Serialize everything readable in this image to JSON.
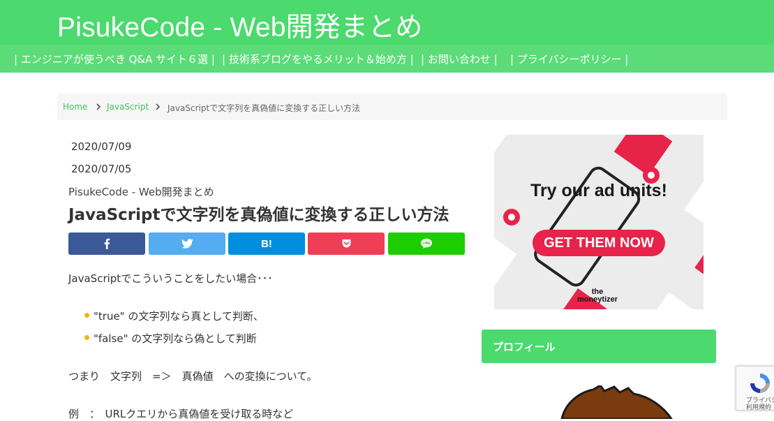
{
  "header": {
    "site_title": "PisukeCode - Web開発まとめ",
    "nav": [
      "| エンジニアが使うべき Q&A サイト６選 |",
      "| 技術系ブログをやるメリット＆始め方 |",
      "| お問い合わせ |",
      "| プライバシーポリシー |"
    ]
  },
  "breadcrumb": {
    "home": "Home",
    "category": "JavaScript",
    "current": "JavaScriptで文字列を真偽値に変換する正しい方法"
  },
  "post": {
    "updated_date": "2020/07/09",
    "published_date": "2020/07/05",
    "author": "PisukeCode - Web開発まとめ",
    "title": "JavaScriptで文字列を真偽値に変換する正しい方法",
    "share_buttons": [
      {
        "name": "facebook",
        "glyph": "f",
        "color": "#3b5998"
      },
      {
        "name": "twitter",
        "glyph": "t",
        "color": "#55acee"
      },
      {
        "name": "hatena",
        "glyph": "B!",
        "color": "#008fde"
      },
      {
        "name": "pocket",
        "glyph": "p",
        "color": "#ef3f56"
      },
      {
        "name": "line",
        "glyph": "LINE",
        "color": "#1dcd00"
      }
    ],
    "intro": "JavaScriptでこういうことをしたい場合･･･",
    "list": [
      "\"true\" の文字列なら真として判断、",
      "\"false\" の文字列なら偽として判断"
    ],
    "summary": "つまり　文字列　=＞　真偽値　への変換について。",
    "example": "例　：　URLクエリから真偽値を受け取る時など"
  },
  "ad": {
    "headline": "Try our ad units!",
    "cta": "GET THEM NOW",
    "brand_line1": "the",
    "brand_line2": "moneytizer"
  },
  "sidebar": {
    "profile_title": "プロフィール"
  },
  "recaptcha": {
    "line1": "プライバシー",
    "line2": "利用規約"
  },
  "colors": {
    "brand_green": "#4cd96d",
    "accent_bullet": "#f2b705"
  }
}
